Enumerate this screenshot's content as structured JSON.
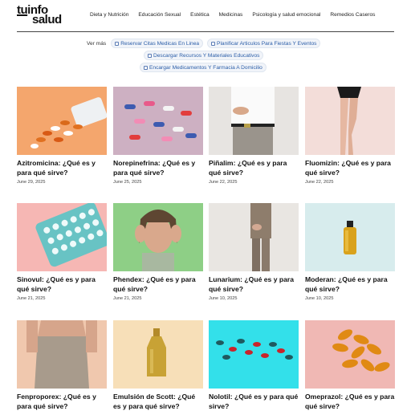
{
  "logo": {
    "line1_a": "tu",
    "line1_b": "info",
    "line2": "salud"
  },
  "nav": [
    "Dieta y Nutrición",
    "Educación Sexual",
    "Estética",
    "Medicinas",
    "Psicología y salud emocional",
    "Remedios Caseros"
  ],
  "vermas": {
    "label": "Ver más",
    "pills": [
      "Reservar Citas Medicas En Linea",
      "Planificar Articulos Para Fiestas Y Eventos",
      "Descargar Recursos Y Materiales Educativos",
      "Encargar Medicamentos Y Farmacia A Domicilio"
    ]
  },
  "articles": [
    {
      "title": "Azitromicina: ¿Qué es y para qué sirve?",
      "date": "June 29, 2025",
      "image": "pills-spilling-from-bottle"
    },
    {
      "title": "Norepinefrina: ¿Qué es y para qué sirve?",
      "date": "June 25, 2025",
      "image": "assorted-capsules"
    },
    {
      "title": "Piñalim: ¿Qué es y para qué sirve?",
      "date": "June 22, 2025",
      "image": "man-holding-stomach"
    },
    {
      "title": "Fluomizin: ¿Qué es y para qué sirve?",
      "date": "June 22, 2025",
      "image": "woman-legs"
    },
    {
      "title": "Sinovul: ¿Qué es y para qué sirve?",
      "date": "June 21, 2025",
      "image": "birth-control-blister"
    },
    {
      "title": "Phendex: ¿Qué es y para qué sirve?",
      "date": "June 21, 2025",
      "image": "woman-headache"
    },
    {
      "title": "Lunarium: ¿Qué es y para qué sirve?",
      "date": "June 10, 2025",
      "image": "person-standing"
    },
    {
      "title": "Moderan: ¿Qué es y para qué sirve?",
      "date": "June 10, 2025",
      "image": "oil-bottle"
    },
    {
      "title": "Fenproporex: ¿Qué es y para qué sirve?",
      "date": "",
      "image": "woman-waist"
    },
    {
      "title": "Emulsión de Scott: ¿Qué es y para qué sirve?",
      "date": "",
      "image": "syrup-bottle"
    },
    {
      "title": "Nolotil: ¿Qué es y para qué sirve?",
      "date": "",
      "image": "red-green-pills"
    },
    {
      "title": "Omeprazol: ¿Qué es y para qué sirve?",
      "date": "",
      "image": "softgel-capsules"
    }
  ]
}
